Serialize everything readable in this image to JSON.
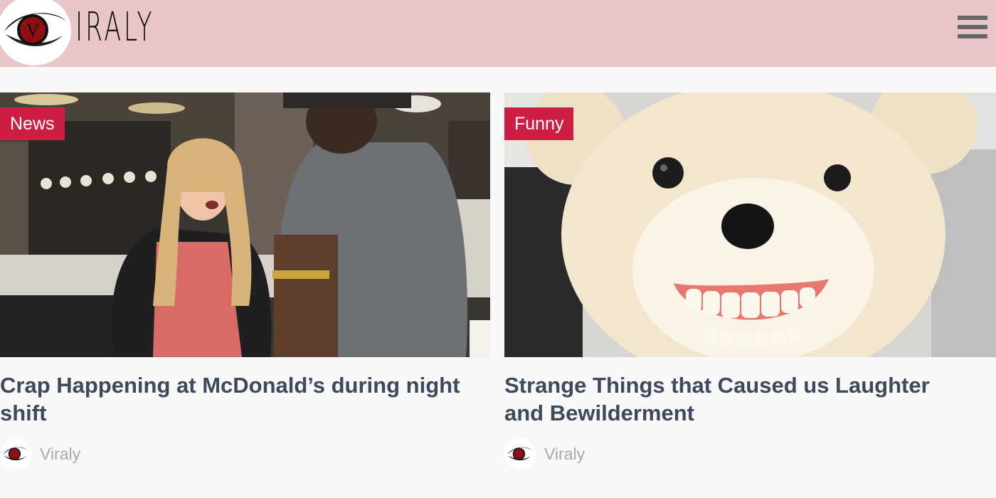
{
  "header": {
    "logo_text": "IRALY",
    "logo_letter": "V",
    "background": "#e8c6c8",
    "menu_icon": "hamburger-menu-icon"
  },
  "articles": [
    {
      "category": "News",
      "title": "Crap Happening at McDonald’s during night shift",
      "author": "Viraly",
      "image": "woman-arguing-with-mcdonalds-employee"
    },
    {
      "category": "Funny",
      "title": "Strange Things that Caused us Laughter and Bewilderment",
      "author": "Viraly",
      "image": "teddy-bear-with-dentures"
    }
  ],
  "colors": {
    "badge": "#cc1f43",
    "title": "#3e4a5c",
    "author": "#a9a9a9"
  }
}
